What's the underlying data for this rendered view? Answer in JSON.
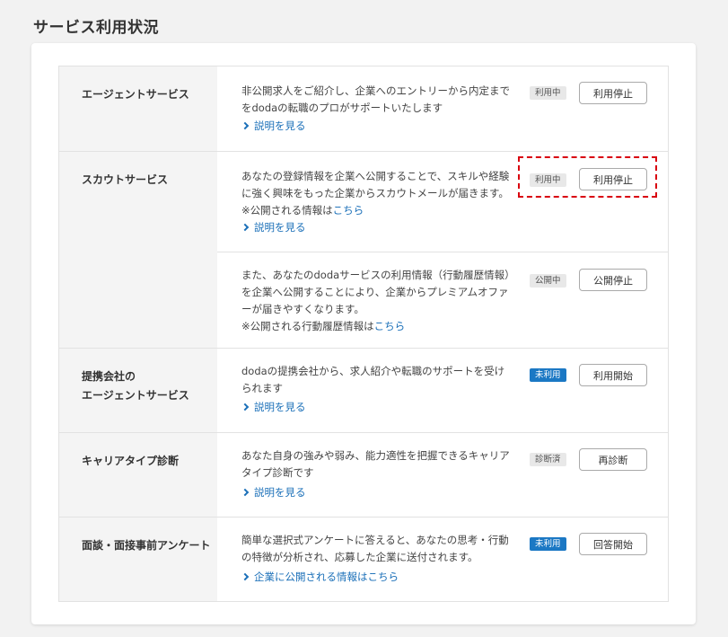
{
  "page": {
    "title": "サービス利用状況"
  },
  "services": [
    {
      "label": "エージェントサービス",
      "desc": "非公開求人をご紹介し、企業へのエントリーから内定までをdodaの転職のプロがサポートいたします",
      "more": "説明を見る",
      "status": "利用中",
      "button": "利用停止"
    },
    {
      "label": "スカウトサービス",
      "desc": "あなたの登録情報を企業へ公開することで、スキルや経験に強く興味をもった企業からスカウトメールが届きます。　※公開される情報は",
      "desc_link": "こちら",
      "more": "説明を見る",
      "status": "利用中",
      "button": "利用停止",
      "sub2": {
        "desc": "また、あなたのdodaサービスの利用情報（行動履歴情報）を企業へ公開することにより、企業からプレミアムオファーが届きやすくなります。",
        "note": "※公開される行動履歴情報は",
        "note_link": "こちら",
        "status": "公開中",
        "button": "公開停止"
      }
    },
    {
      "label_line1": "提携会社の",
      "label_line2": "エージェントサービス",
      "desc": "dodaの提携会社から、求人紹介や転職のサポートを受けられます",
      "more": "説明を見る",
      "status": "未利用",
      "button": "利用開始"
    },
    {
      "label": "キャリアタイプ診断",
      "desc": "あなた自身の強みや弱み、能力適性を把握できるキャリアタイプ診断です",
      "more": "説明を見る",
      "status": "診断済",
      "button": "再診断"
    },
    {
      "label": "面談・面接事前アンケート",
      "desc": "簡単な選択式アンケートに答えると、あなたの思考・行動の特徴が分析され、応募した企業に送付されます。",
      "more": "企業に公開される情報はこちら",
      "status": "未利用",
      "button": "回答開始"
    }
  ]
}
